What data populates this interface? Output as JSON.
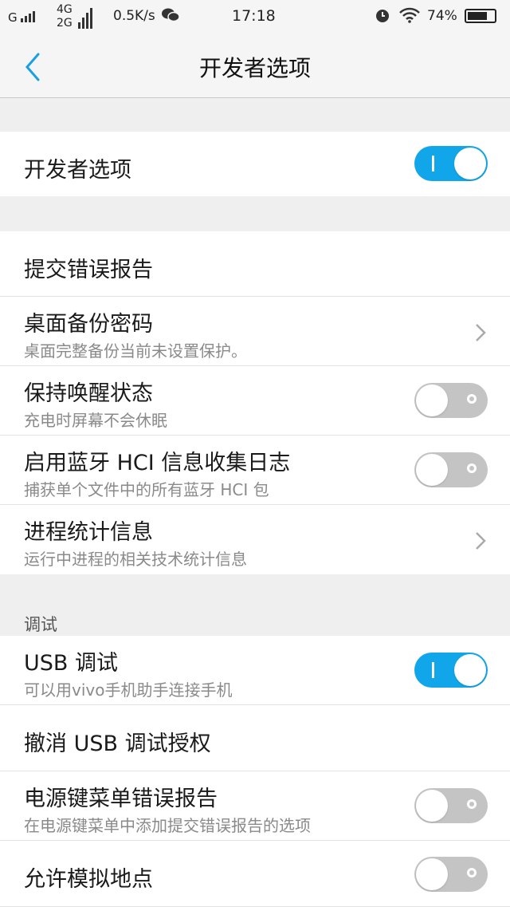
{
  "status_bar": {
    "carrier_g": "G",
    "net_top": "4G",
    "net_bottom": "2G",
    "speed": "0.5K/s",
    "time": "17:18",
    "battery": "74%",
    "battery_level": 0.74
  },
  "nav": {
    "title": "开发者选项"
  },
  "master": {
    "title": "开发者选项",
    "toggle": "on"
  },
  "group1": [
    {
      "title": "提交错误报告"
    },
    {
      "title": "桌面备份密码",
      "subtitle": "桌面完整备份当前未设置保护。",
      "control": "chevron"
    },
    {
      "title": "保持唤醒状态",
      "subtitle": "充电时屏幕不会休眠",
      "control": "toggle-off"
    },
    {
      "title": "启用蓝牙 HCI 信息收集日志",
      "subtitle": "捕获单个文件中的所有蓝牙 HCI 包",
      "control": "toggle-off"
    },
    {
      "title": "进程统计信息",
      "subtitle": "运行中进程的相关技术统计信息",
      "control": "chevron"
    }
  ],
  "debug_section": {
    "header": "调试",
    "items": [
      {
        "title": "USB 调试",
        "subtitle": "可以用vivo手机助手连接手机",
        "control": "toggle-on"
      },
      {
        "title": "撤消 USB 调试授权"
      },
      {
        "title": "电源键菜单错误报告",
        "subtitle": "在电源键菜单中添加提交错误报告的选项",
        "control": "toggle-off"
      },
      {
        "title": "允许模拟地点",
        "control": "toggle-off"
      }
    ]
  },
  "colors": {
    "accent": "#11a6ea",
    "toggle_off": "#c4c4c4",
    "background": "#efeff0"
  }
}
